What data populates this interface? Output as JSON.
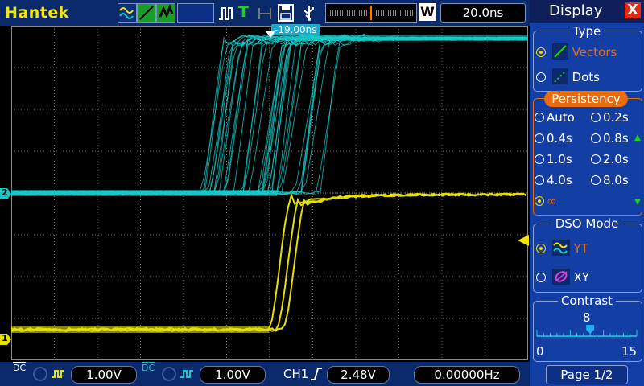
{
  "brand": "Hantek",
  "toolbar": {
    "timebase": "20.0ns",
    "memory_label": "W"
  },
  "screen": {
    "trigger_offset": "-19.00ns",
    "ch1_marker": "1",
    "ch2_marker": "2",
    "colors": {
      "ch1": "#e6e000",
      "ch2": "#18c8c8",
      "grid": "#6e6e6e",
      "trigger": "#f5e400"
    }
  },
  "bottom": {
    "ch1_coupling": "DC",
    "ch1_scale": "1.00V",
    "ch2_coupling": "DC",
    "ch2_scale": "1.00V",
    "trigger_source": "CH1",
    "trigger_level": "2.48V",
    "frequency": "0.00000Hz"
  },
  "panel": {
    "title": "Display",
    "close": "X",
    "type": {
      "title": "Type",
      "options": [
        "Vectors",
        "Dots"
      ],
      "selected": 0
    },
    "persistency": {
      "title": "Persistency",
      "options": [
        "Auto",
        "0.2s",
        "0.4s",
        "0.8s",
        "1.0s",
        "2.0s",
        "4.0s",
        "8.0s",
        "∞"
      ],
      "selected": 8
    },
    "dso_mode": {
      "title": "DSO Mode",
      "options": [
        "YT",
        "XY"
      ],
      "selected": 0
    },
    "contrast": {
      "title": "Contrast",
      "value": "8",
      "min": "0",
      "max": "15",
      "level": 8
    },
    "page": "Page 1/2"
  }
}
